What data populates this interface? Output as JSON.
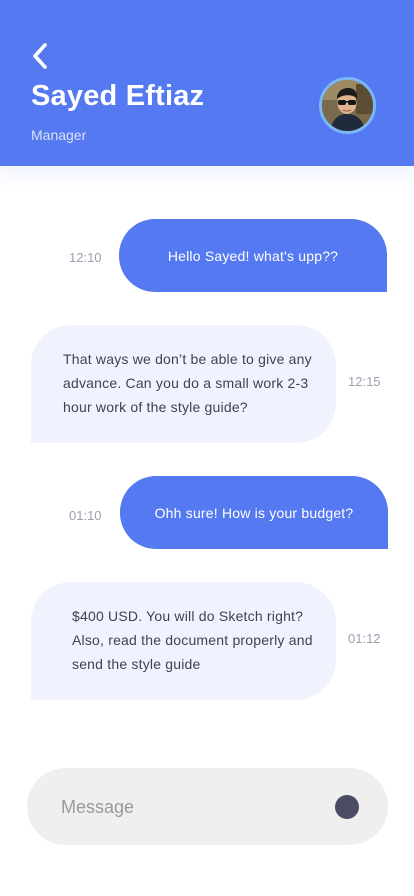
{
  "header": {
    "title": "Sayed Eftiaz",
    "subtitle": "Manager",
    "back_icon": "chevron-left-icon",
    "avatar_icon": "user-avatar"
  },
  "messages": [
    {
      "direction": "outgoing",
      "text": "Hello Sayed! what's upp??",
      "time": "12:10"
    },
    {
      "direction": "incoming",
      "lines": [
        "That ways we don’t be able to give any",
        "advance. Can you do a small work 2-3",
        "hour work of the style guide?"
      ],
      "time": "12:15"
    },
    {
      "direction": "outgoing",
      "text": "Ohh sure! How is your budget?",
      "time": "01:10"
    },
    {
      "direction": "incoming",
      "lines": [
        "$400 USD. You will do Sketch right?",
        "Also, read the document properly and",
        "send the style guide"
      ],
      "time": "01:12"
    }
  ],
  "composer": {
    "placeholder": "Message",
    "value": "",
    "send_icon": "send-dot-icon"
  },
  "colors": {
    "accent": "#5479f0",
    "incoming_bubble": "#f0f3fd",
    "text_dark": "#3d4257",
    "time_text": "#9aa0b0",
    "composer_bg": "#efefef",
    "send_dot": "#4a4c66"
  }
}
